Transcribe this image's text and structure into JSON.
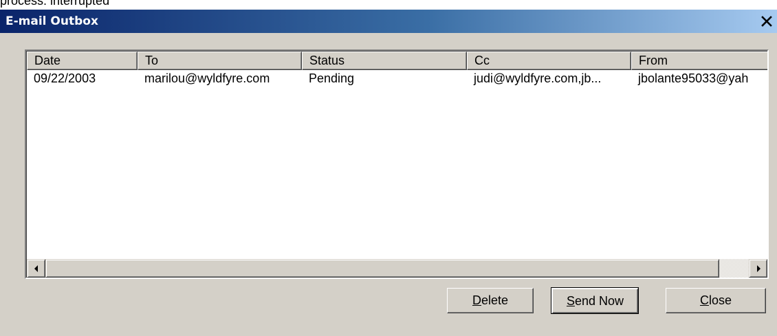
{
  "window": {
    "title": "E-mail Outbox",
    "close_glyph": "×"
  },
  "top_strip": {
    "partial_text": "process: interrupted"
  },
  "listview": {
    "columns": [
      {
        "key": "date",
        "label": "Date"
      },
      {
        "key": "to",
        "label": "To"
      },
      {
        "key": "status",
        "label": "Status"
      },
      {
        "key": "cc",
        "label": "Cc"
      },
      {
        "key": "from",
        "label": "From"
      }
    ],
    "rows": [
      {
        "date": "09/22/2003",
        "to": "marilou@wyldfyre.com",
        "status": "Pending",
        "cc": "judi@wyldfyre.com,jb...",
        "from": "jbolante95033@yah"
      }
    ]
  },
  "scrollbar": {
    "left_arrow_icon": "arrow-left-icon",
    "right_arrow_icon": "arrow-right-icon"
  },
  "buttons": {
    "delete": {
      "mnemonic": "D",
      "rest": "elete"
    },
    "send_now": {
      "mnemonic": "S",
      "rest": "end Now"
    },
    "close": {
      "mnemonic": "C",
      "rest": "lose"
    }
  }
}
